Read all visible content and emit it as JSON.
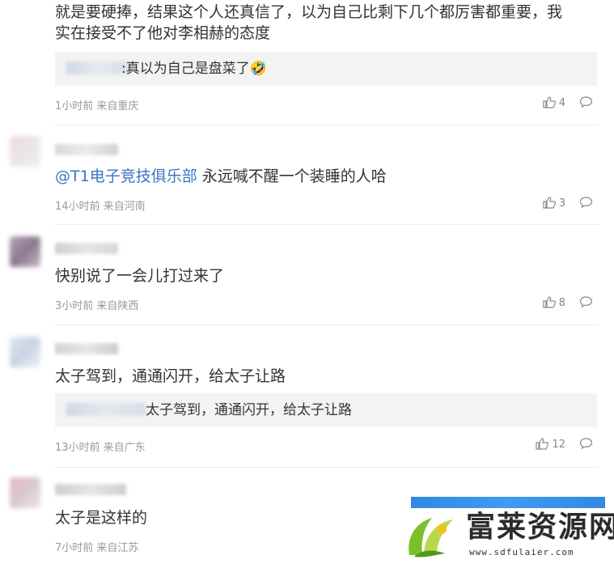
{
  "comments": [
    {
      "text_line1": "就是要硬捧，结果这个人还真信了，以为自己比剩下几个都厉害都重要，我",
      "text_line2": "实在接受不了他对李相赫的态度",
      "quote": ":真以为自己是盘菜了🤣",
      "time": "1小时前 来自重庆",
      "likes": "4"
    },
    {
      "mention": "@T1电子竞技俱乐部",
      "text": " 永远喊不醒一个装睡的人哈",
      "time": "14小时前 来自河南",
      "likes": "3"
    },
    {
      "text": "快别说了一会儿打过来了",
      "time": "3小时前 来自陕西",
      "likes": "8"
    },
    {
      "text": "太子驾到，通通闪开，给太子让路",
      "quote": "太子驾到，通通闪开，给太子让路",
      "time": "13小时前 来自广东",
      "likes": "12"
    },
    {
      "text": "太子是这样的",
      "time": "7小时前 来自江苏"
    }
  ],
  "watermark": {
    "title": "富莱资源网",
    "url": "www.sdfulaier.com"
  },
  "colors": {
    "mention": "#3a76c4",
    "meta": "#999999",
    "quote_bg": "#f3f3f3"
  },
  "icons": [
    "thumbs-up-icon",
    "reply-icon",
    "grass-logo-icon"
  ]
}
